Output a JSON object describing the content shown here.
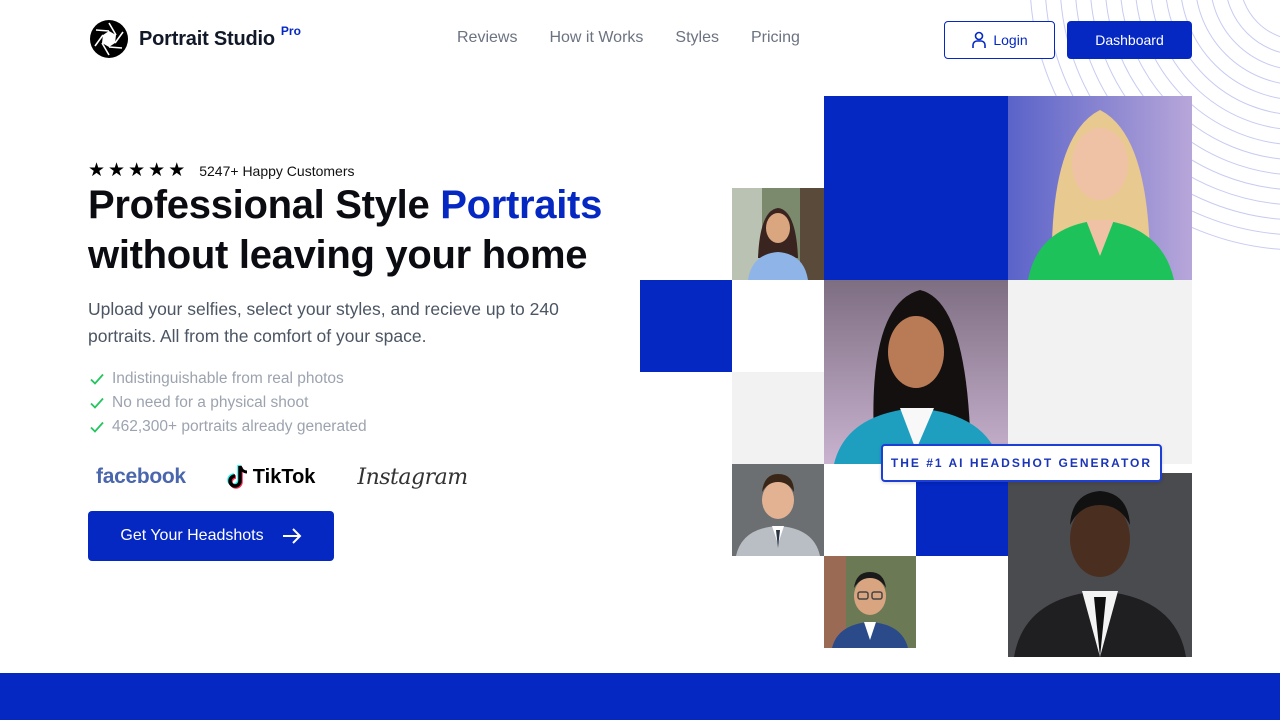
{
  "brand": {
    "name": "Portrait Studio",
    "badge": "Pro"
  },
  "nav": {
    "items": [
      {
        "label": "Reviews"
      },
      {
        "label": "How it Works"
      },
      {
        "label": "Styles"
      },
      {
        "label": "Pricing"
      }
    ]
  },
  "header_actions": {
    "login_label": "Login",
    "login_icon": "user-icon",
    "dashboard_label": "Dashboard"
  },
  "hero": {
    "rating": {
      "stars": 5,
      "star_glyph": "★",
      "text": "5247+ Happy Customers"
    },
    "title_part1": "Professional Style ",
    "title_accent": "Portraits",
    "title_line2": "without leaving your home",
    "subtitle": "Upload your selfies, select your styles, and recieve up to 240 portraits. All from the comfort of your space.",
    "features": [
      {
        "text": "Indistinguishable from real photos",
        "icon": "check-icon"
      },
      {
        "text": "No need for a physical shoot",
        "icon": "check-icon"
      },
      {
        "text": "462,300+ portraits already generated",
        "icon": "check-icon"
      }
    ],
    "brands": {
      "facebook": "facebook",
      "tiktok": "TikTok",
      "instagram": "Instagram"
    },
    "cta_label": "Get Your Headshots",
    "cta_icon": "arrow-right-icon"
  },
  "gallery": {
    "badge_text": "THE #1 AI HEADSHOT GENERATOR",
    "photos": [
      {
        "name": "photo-woman-blue-shirt",
        "description": "young woman in blue shirt, outdoor"
      },
      {
        "name": "photo-woman-green-blazer",
        "description": "blonde woman in green blazer"
      },
      {
        "name": "photo-woman-teal-blazer",
        "description": "woman in teal blazer"
      },
      {
        "name": "photo-man-gray-suit",
        "description": "smiling man in gray suit"
      },
      {
        "name": "photo-man-glasses",
        "description": "man with glasses in navy suit"
      },
      {
        "name": "photo-man-black-suit",
        "description": "man in black suit and tie"
      }
    ]
  },
  "colors": {
    "primary": "#0527c2",
    "text_dark": "#0b0b12",
    "muted": "#6b7280",
    "check": "#22c55e"
  }
}
